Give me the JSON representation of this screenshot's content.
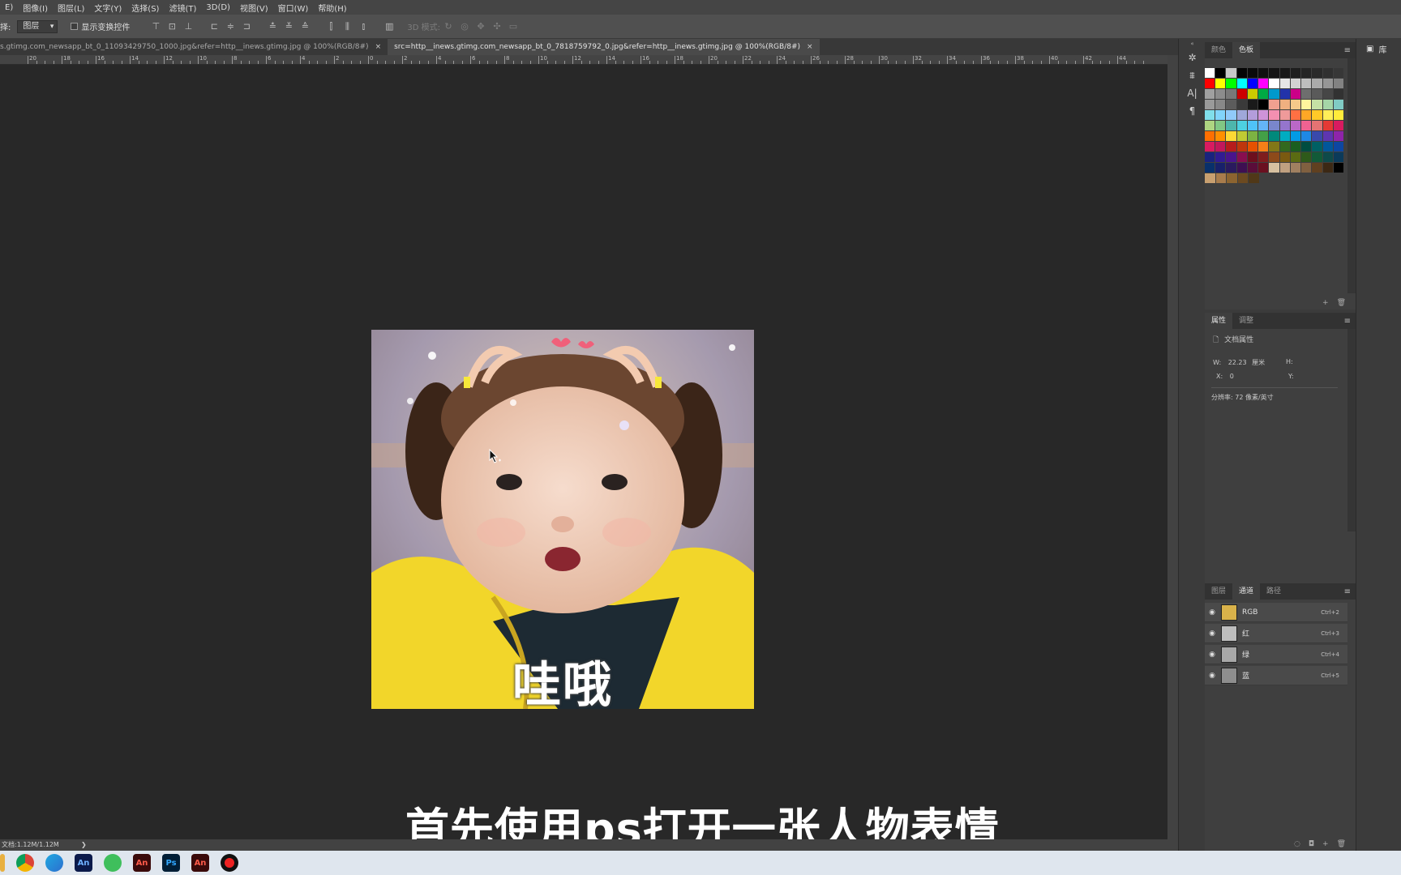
{
  "menubar": {
    "items": [
      "E)",
      "图像(I)",
      "图层(L)",
      "文字(Y)",
      "选择(S)",
      "滤镜(T)",
      "3D(D)",
      "视图(V)",
      "窗口(W)",
      "帮助(H)"
    ]
  },
  "options": {
    "prefix": "择:",
    "layer_select": "图层",
    "transform_label": "显示变换控件",
    "mode3d_label": "3D 模式:"
  },
  "tabs": [
    {
      "label": "s.gtimg.com_newsapp_bt_0_11093429750_1000.jpg&refer=http__inews.gtimg.jpg @ 100%(RGB/8#)",
      "close": "×"
    },
    {
      "label": "src=http__inews.gtimg.com_newsapp_bt_0_7818759792_0.jpg&refer=http__inews.gtimg.jpg @ 100%(RGB/8#)",
      "close": "×"
    }
  ],
  "ruler": {
    "labels": [
      "20",
      "18",
      "16",
      "14",
      "12",
      "10",
      "8",
      "6",
      "4",
      "2",
      "0",
      "2",
      "4",
      "6",
      "8",
      "10",
      "12",
      "14",
      "16",
      "18",
      "20",
      "22",
      "24",
      "26",
      "28",
      "30",
      "32",
      "34",
      "36",
      "38",
      "40",
      "42",
      "44"
    ]
  },
  "image": {
    "caption": "哇哦"
  },
  "subtitle": "首先使用ps打开一张人物表情",
  "status": {
    "doc": "文档:1.12M/1.12M",
    "arrow": "❯"
  },
  "swatches_panel": {
    "tabs": [
      "颜色",
      "色板"
    ],
    "rows": [
      [
        "#ffffff",
        "#000000",
        "#c8c8c8",
        "#050505",
        "#0a0a0a",
        "#101010",
        "#141414",
        "#181818",
        "#1e1e1e",
        "#242424",
        "#2a2a2a",
        "#303030",
        "#373737"
      ],
      [
        "#ff0000",
        "#ffff00",
        "#00ff00",
        "#00ffff",
        "#0000ff",
        "#ff00ff",
        "#ffffff",
        "#e6e6e6",
        "#d2d2d2",
        "#bebebe",
        "#aaaaaa",
        "#969696",
        "#828282"
      ],
      [
        "#a0a0a0",
        "#8c8c8c",
        "#787878",
        "#cc0000",
        "#cccc00",
        "#00aa44",
        "#0099cc",
        "#2233aa",
        "#cc0088",
        "#6e6e6e",
        "#5a5a5a",
        "#464646",
        "#323232"
      ],
      [
        "#9a9a9a",
        "#888888",
        "#5c5c5c",
        "#3a3a3a",
        "#1a1a1a",
        "#000000",
        "#f0a090",
        "#f0b080",
        "#f5c98a",
        "#fff59d",
        "#c5e1a5",
        "#a5d6a7",
        "#80cbc4"
      ],
      [
        "#80deea",
        "#81d4fa",
        "#90caf9",
        "#9fa8da",
        "#b39ddb",
        "#ce93d8",
        "#f48fb1",
        "#ef9a9a",
        "#ff7043",
        "#ffa726",
        "#ffca28",
        "#ffee58",
        "#ffeb3b"
      ],
      [
        "#aed581",
        "#81c784",
        "#4db6ac",
        "#4dd0e1",
        "#4fc3f7",
        "#64b5f6",
        "#7986cb",
        "#9575cd",
        "#ba68c8",
        "#f06292",
        "#e57373",
        "#e53935",
        "#d81b60"
      ],
      [
        "#ff6f00",
        "#ff8f00",
        "#fdd835",
        "#c0ca33",
        "#7cb342",
        "#43a047",
        "#00897b",
        "#00acc1",
        "#039be5",
        "#1e88e5",
        "#3949ab",
        "#5e35b1",
        "#8e24aa"
      ],
      [
        "#d81b60",
        "#c2185b",
        "#b71c1c",
        "#bf360c",
        "#e65100",
        "#f57f17",
        "#827717",
        "#33691e",
        "#1b5e20",
        "#004d40",
        "#006064",
        "#01579b",
        "#0d47a1"
      ],
      [
        "#1a237e",
        "#311b92",
        "#4a148c",
        "#880e4f",
        "#6d0f1e",
        "#7f1d1d",
        "#8d4a1a",
        "#7a5a10",
        "#5a6b12",
        "#2e5a1a",
        "#125a38",
        "#0e4a4a",
        "#0b3a5a"
      ],
      [
        "#08306b",
        "#18206a",
        "#2a1a5e",
        "#3e0f52",
        "#5a0d3a",
        "#6a1020",
        "#d7c0a0",
        "#c0a080",
        "#a08060",
        "#806040",
        "#604020",
        "#3c2814",
        "#000000"
      ],
      [
        "#c8a070",
        "#a87c4c",
        "#8c6430",
        "#6c4a20",
        "#503818"
      ]
    ],
    "footer": [
      "+",
      "🗑"
    ]
  },
  "properties_panel": {
    "tabs": [
      "属性",
      "调整"
    ],
    "doc_label": "文档属性",
    "w_label": "W:",
    "w_value": "22.23",
    "w_unit": "厘米",
    "h_label": "H:",
    "x_label": "X:",
    "x_value": "0",
    "y_label": "Y:",
    "resolution": "分辨率: 72 像素/英寸"
  },
  "channels_panel": {
    "tabs": [
      "图层",
      "通道",
      "路径"
    ],
    "rows": [
      {
        "name": "RGB",
        "shortcut": "Ctrl+2"
      },
      {
        "name": "红",
        "shortcut": "Ctrl+3"
      },
      {
        "name": "绿",
        "shortcut": "Ctrl+4"
      },
      {
        "name": "蓝",
        "shortcut": "Ctrl+5"
      }
    ]
  },
  "libraries": {
    "label": "库"
  },
  "taskbar": {
    "apps": [
      "chrome",
      "edge",
      "An",
      "wechat",
      "An",
      "Ps",
      "An",
      "record"
    ]
  }
}
